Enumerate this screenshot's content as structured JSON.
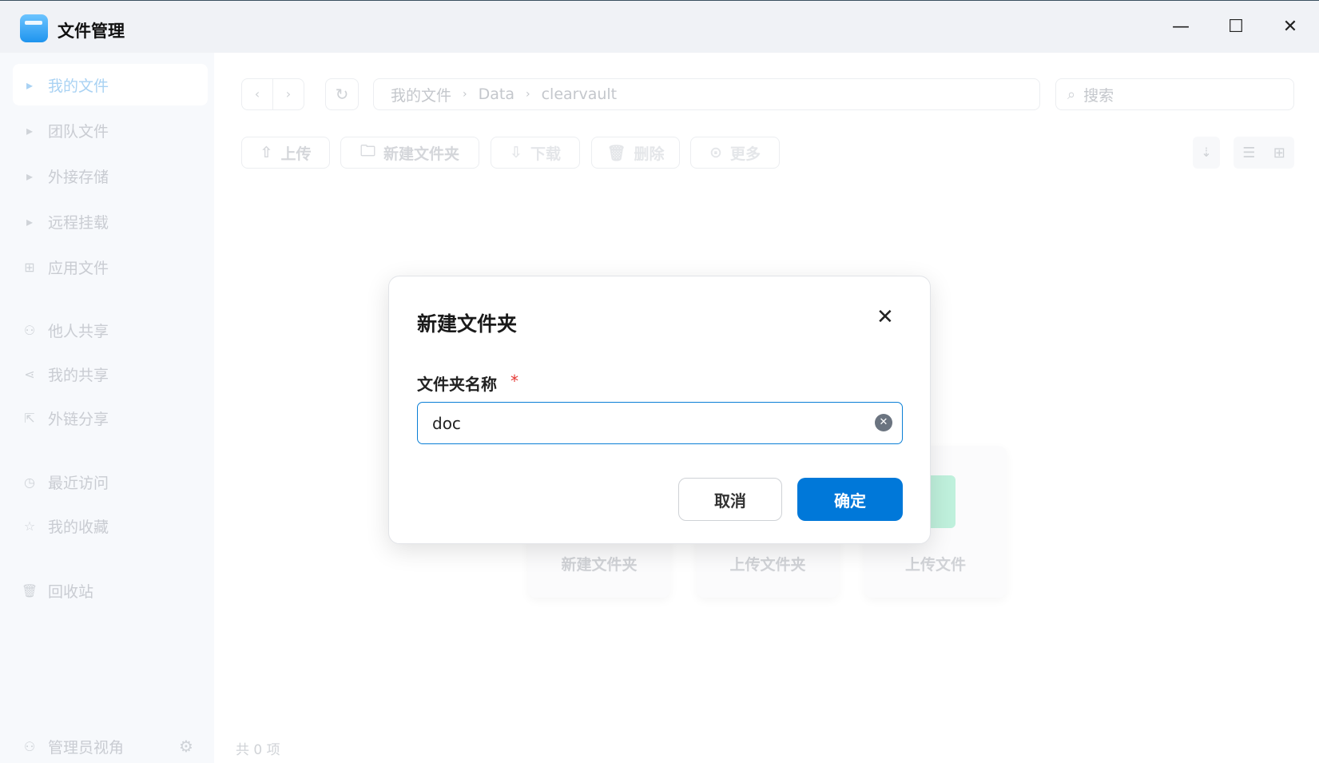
{
  "app": {
    "title": "文件管理"
  },
  "sidebar": {
    "items": [
      {
        "label": "我的文件",
        "icon": "caret-right-icon"
      },
      {
        "label": "团队文件",
        "icon": "caret-right-icon"
      },
      {
        "label": "外接存储",
        "icon": "caret-right-icon"
      },
      {
        "label": "远程挂载",
        "icon": "caret-right-icon"
      },
      {
        "label": "应用文件",
        "icon": "apps-icon"
      },
      {
        "label": "他人共享",
        "icon": "users-icon"
      },
      {
        "label": "我的共享",
        "icon": "share-icon"
      },
      {
        "label": "外链分享",
        "icon": "external-share-icon"
      },
      {
        "label": "最近访问",
        "icon": "clock-icon"
      },
      {
        "label": "我的收藏",
        "icon": "star-icon"
      },
      {
        "label": "回收站",
        "icon": "trash-icon"
      }
    ],
    "admin_view": "管理员视角"
  },
  "breadcrumb": [
    "我的文件",
    "Data",
    "clearvault"
  ],
  "search": {
    "placeholder": "搜索"
  },
  "toolbar": {
    "upload": "上传",
    "new_folder": "新建文件夹",
    "download": "下载",
    "delete": "删除",
    "more": "更多"
  },
  "empty_actions": [
    "新建文件夹",
    "上传文件夹",
    "上传文件"
  ],
  "footer": {
    "count": "共 0 项"
  },
  "dialog": {
    "title": "新建文件夹",
    "field_label": "文件夹名称",
    "required_mark": "*",
    "value": "doc",
    "cancel": "取消",
    "confirm": "确定"
  },
  "colors": {
    "accent": "#0078d9"
  }
}
